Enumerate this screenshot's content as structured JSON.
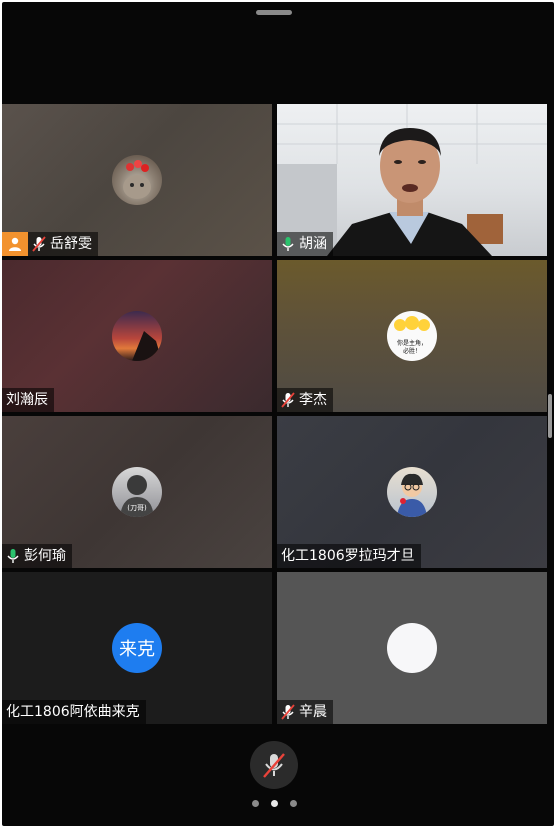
{
  "participants": [
    {
      "name": "岳舒雯",
      "mic": "muted",
      "host": true
    },
    {
      "name": "胡涵",
      "mic": "on",
      "active_speaker": true
    },
    {
      "name": "刘瀚辰",
      "mic": "none"
    },
    {
      "name": "李杰",
      "mic": "muted"
    },
    {
      "name": "彭何瑜",
      "mic": "on"
    },
    {
      "name": "化工1806罗拉玛才旦",
      "mic": "none"
    },
    {
      "name": "化工1806阿依曲来克",
      "mic": "none",
      "avatar_text": "来克",
      "avatar_color": "#1e7df0"
    },
    {
      "name": "辛晨",
      "mic": "muted"
    }
  ],
  "avatars": {
    "p4_text_line1": "你是主角，",
    "p4_text_line2": "必胜！",
    "p5_text": "(刀哥)"
  },
  "controls": {
    "mute_button_icon": "mic-muted-icon",
    "page_indicator": {
      "pages": 3,
      "current": 2
    }
  },
  "colors": {
    "active_border": "#2ac36d",
    "host_badge": "#f2922e",
    "mic_on": "#2ac36d",
    "mic_muted": "#e9433a"
  }
}
